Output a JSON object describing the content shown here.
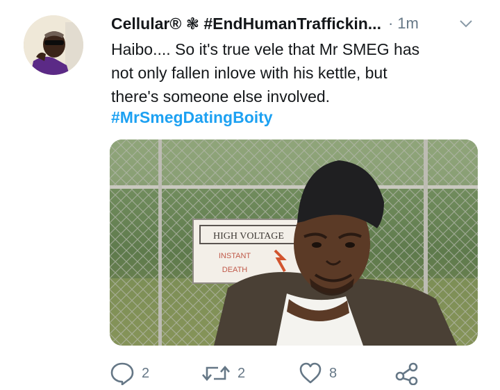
{
  "tweet": {
    "display_name": "Cellular® ❃ #EndHumanTraffickin...",
    "separator": "·",
    "time": "1m",
    "text_lines": [
      "Haibo.... So it's true vele that Mr SMEG has",
      "not only fallen inlove with his kettle, but",
      "there's someone else involved."
    ],
    "hashtag": "#MrSmegDatingBoity",
    "media": {
      "sign_line1": "HIGH VOLTAGE",
      "sign_line2": "INSTANT",
      "sign_line3": "DEATH"
    }
  },
  "actions": {
    "replies": "2",
    "retweets": "2",
    "likes": "8"
  },
  "colors": {
    "link": "#1da1f2",
    "secondary_text": "#657786",
    "primary_text": "#14171a"
  },
  "icons": [
    "reply-icon",
    "retweet-icon",
    "heart-icon",
    "share-icon",
    "chevron-down-icon"
  ]
}
